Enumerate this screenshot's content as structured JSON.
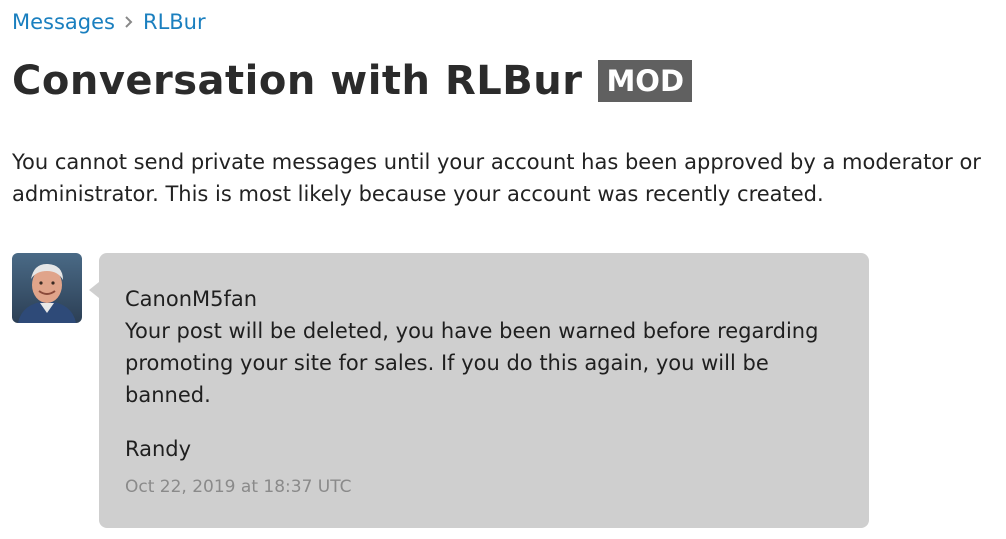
{
  "breadcrumb": {
    "root_label": "Messages",
    "current_label": "RLBur"
  },
  "header": {
    "title": "Conversation with RLBur",
    "badge": "MOD"
  },
  "notice": {
    "text": "You cannot send private messages until your account has been approved by a moderator or administrator. This is most likely because your account was recently created."
  },
  "message": {
    "avatar_icon": "user-photo-avatar",
    "greeting": "CanonM5fan",
    "body": "Your post will be deleted, you have been warned before regarding promoting your site for sales. If you do this again, you will be banned.",
    "signature": "Randy",
    "timestamp": "Oct 22, 2019 at 18:37 UTC"
  },
  "colors": {
    "link": "#1a7fbf",
    "badge_bg": "#606060",
    "bubble_bg": "#cfcfcf",
    "timestamp": "#8a8a8a"
  }
}
